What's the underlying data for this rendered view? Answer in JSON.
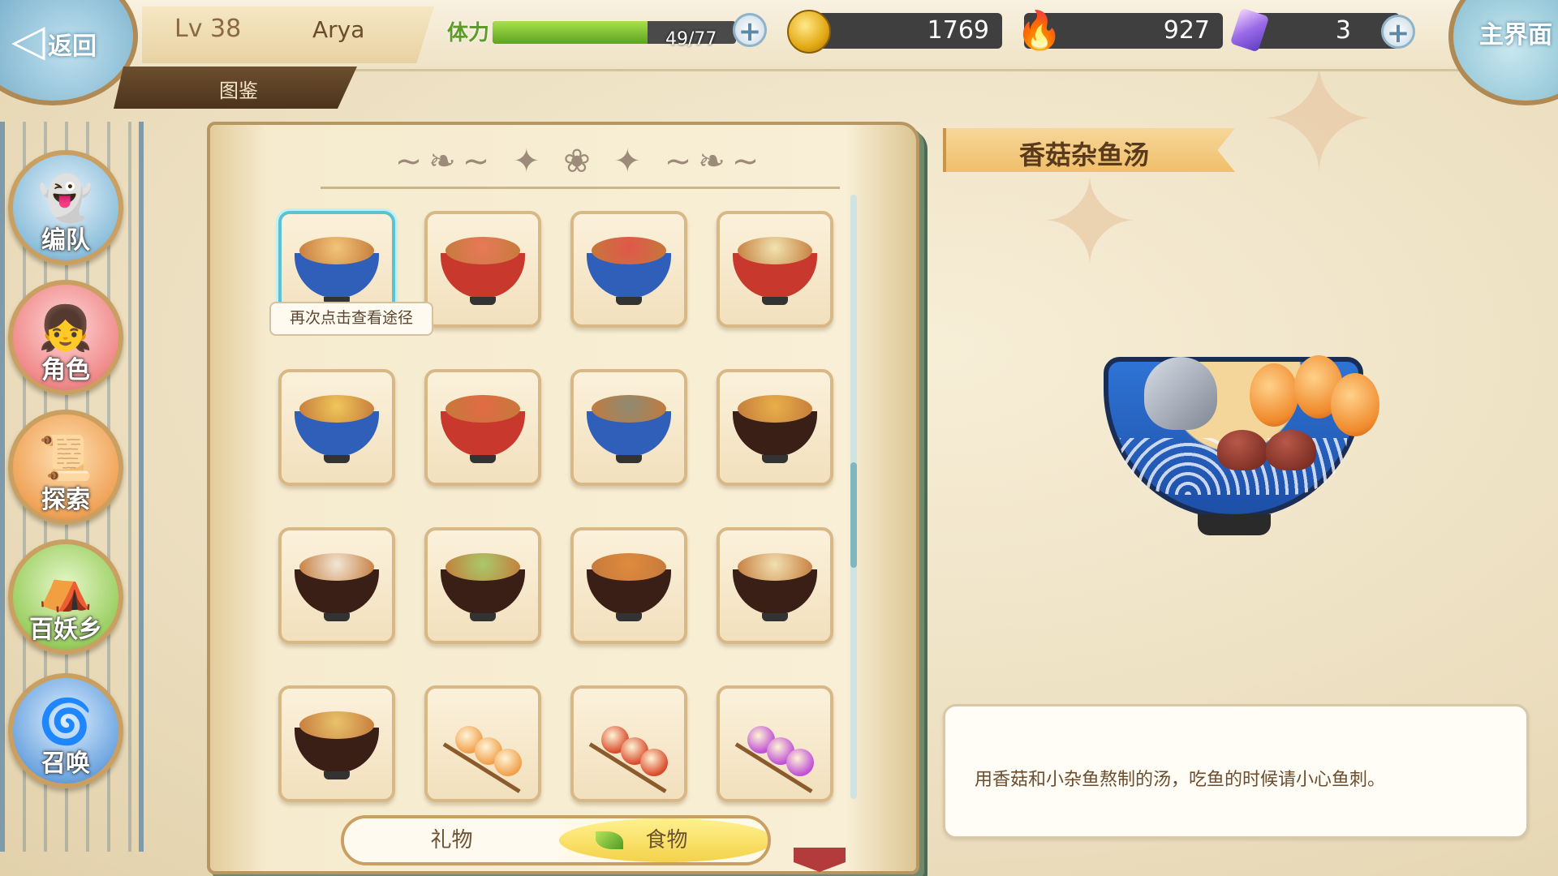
{
  "header": {
    "back_label": "返回",
    "level": "Lv 38",
    "player_name": "Arya",
    "codex_tab": "图鉴",
    "stamina_label": "体力",
    "stamina_text": "49/77",
    "stamina_fraction": 0.636,
    "gold": "1769",
    "spirit": "927",
    "crystal": "3",
    "home_label": "主界面"
  },
  "sidebar": {
    "items": [
      {
        "label": "编队",
        "icon": "team-icon"
      },
      {
        "label": "角色",
        "icon": "character-icon"
      },
      {
        "label": "探索",
        "icon": "explore-icon"
      },
      {
        "label": "百妖乡",
        "icon": "village-icon"
      },
      {
        "label": "召唤",
        "icon": "summon-icon"
      }
    ]
  },
  "codex": {
    "tooltip": "再次点击查看途径",
    "tabs": {
      "gift": "礼物",
      "food": "食物"
    },
    "items": [
      {
        "kind": "bowl",
        "bowl": "#2f5fb8",
        "food": "#f3c47a",
        "selected": true
      },
      {
        "kind": "bowl",
        "bowl": "#c8382c",
        "food": "#e8795a"
      },
      {
        "kind": "bowl",
        "bowl": "#2f5fb8",
        "food": "#e0574b"
      },
      {
        "kind": "bowl",
        "bowl": "#c8382c",
        "food": "#f1e3b0"
      },
      {
        "kind": "bowl",
        "bowl": "#2f5fb8",
        "food": "#f0c65a"
      },
      {
        "kind": "bowl",
        "bowl": "#c8382c",
        "food": "#e26a45"
      },
      {
        "kind": "bowl",
        "bowl": "#2f5fb8",
        "food": "#8f8a73"
      },
      {
        "kind": "bowl",
        "bowl": "#3a1f17",
        "food": "#e8b04a"
      },
      {
        "kind": "bowl",
        "bowl": "#3a1f17",
        "food": "#f2e6d6"
      },
      {
        "kind": "bowl",
        "bowl": "#3a1f17",
        "food": "#a9c96a"
      },
      {
        "kind": "bowl",
        "bowl": "#3a1f17",
        "food": "#e08a3e"
      },
      {
        "kind": "bowl",
        "bowl": "#3a1f17",
        "food": "#f1dfb0"
      },
      {
        "kind": "bowl",
        "bowl": "#3a1f17",
        "food": "#e9c26b"
      },
      {
        "kind": "skewer",
        "food": "#f1a04b"
      },
      {
        "kind": "skewer",
        "food": "#d84a2a"
      },
      {
        "kind": "skewer",
        "food": "#c04fd6"
      }
    ]
  },
  "detail": {
    "title": "香菇杂鱼汤",
    "description": "用香菇和小杂鱼熬制的汤，吃鱼的时候请小心鱼刺。"
  }
}
